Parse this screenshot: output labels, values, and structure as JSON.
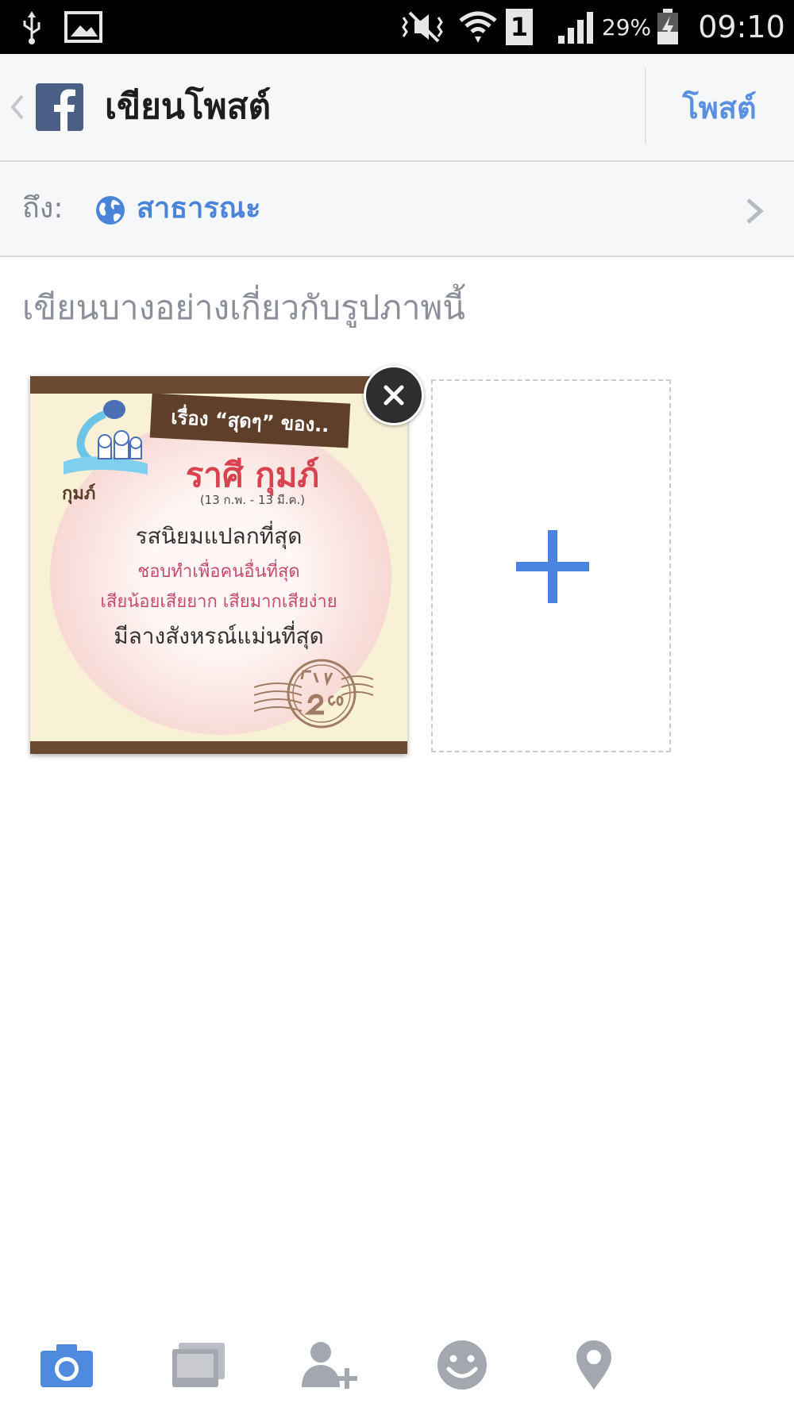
{
  "status_bar": {
    "battery_percent": "29%",
    "time": "09:10",
    "sim_slot": "1"
  },
  "header": {
    "title": "เขียนโพสต์",
    "post_label": "โพสต์"
  },
  "audience": {
    "to_label": "ถึง:",
    "value": "สาธารณะ"
  },
  "composer": {
    "placeholder": "เขียนบางอย่างเกี่ยวกับรูปภาพนี้"
  },
  "photo": {
    "banner": "เรื่อง “สุดๆ” ของ..",
    "title": "ราศี กุมภ์",
    "date_range": "(13 ก.พ. - 13 มี.ค.)",
    "sign_label": "กุมภ์",
    "line1": "รสนิยมแปลกที่สุด",
    "line2": "ชอบทำเพื่อคนอื่นที่สุด",
    "line3": "เสียน้อยเสียยาก เสียมากเสียง่าย",
    "line4": "มีลางสังหรณ์แม่นที่สุด"
  },
  "toolbar": {
    "items": [
      "camera-icon",
      "photo-album-icon",
      "tag-people-icon",
      "feeling-icon",
      "location-icon"
    ]
  },
  "colors": {
    "accent": "#4a84d8",
    "header_bg": "#f6f7f8",
    "facebook_blue": "#4b5f86",
    "add_plus": "#4a84e0"
  }
}
